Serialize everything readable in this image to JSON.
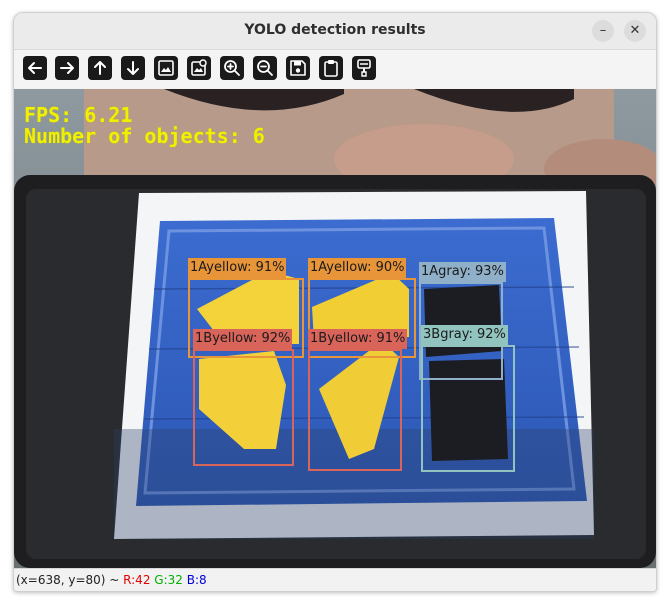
{
  "window": {
    "title": "YOLO detection results"
  },
  "titlebar_buttons": {
    "minimize": "–",
    "close": "✕"
  },
  "toolbar": [
    {
      "name": "pan-left-button",
      "icon": "arrow-left-icon"
    },
    {
      "name": "pan-right-button",
      "icon": "arrow-right-icon"
    },
    {
      "name": "pan-up-button",
      "icon": "arrow-up-icon"
    },
    {
      "name": "pan-down-button",
      "icon": "arrow-down-icon"
    },
    {
      "name": "zoom-original-button",
      "icon": "image-icon"
    },
    {
      "name": "zoom-fit-button",
      "icon": "image-zoom-icon"
    },
    {
      "name": "zoom-in-button",
      "icon": "zoom-in-icon"
    },
    {
      "name": "zoom-out-button",
      "icon": "zoom-out-icon"
    },
    {
      "name": "save-button",
      "icon": "save-icon"
    },
    {
      "name": "copy-clipboard-button",
      "icon": "clipboard-icon"
    },
    {
      "name": "properties-button",
      "icon": "paint-brush-icon"
    }
  ],
  "overlay": {
    "fps": "FPS: 6.21",
    "objects": "Number of objects: 6",
    "color": "#f0f000"
  },
  "detections": [
    {
      "label": "1Ayellow: 91%",
      "color": "#e8953a"
    },
    {
      "label": "1Ayellow: 90%",
      "color": "#e8953a"
    },
    {
      "label": "1Agray: 93%",
      "color": "#8fb0c8"
    },
    {
      "label": "1Byellow: 92%",
      "color": "#d9645a"
    },
    {
      "label": "1Byellow: 91%",
      "color": "#d9645a"
    },
    {
      "label": "3Bgray: 92%",
      "color": "#92c4bf"
    }
  ],
  "status": {
    "coords": "(x=638, y=80) ~ ",
    "r": "R:42",
    "g": "G:32",
    "b": "B:8",
    "r_color": "#e00000",
    "g_color": "#00b000",
    "b_color": "#0000e0"
  }
}
